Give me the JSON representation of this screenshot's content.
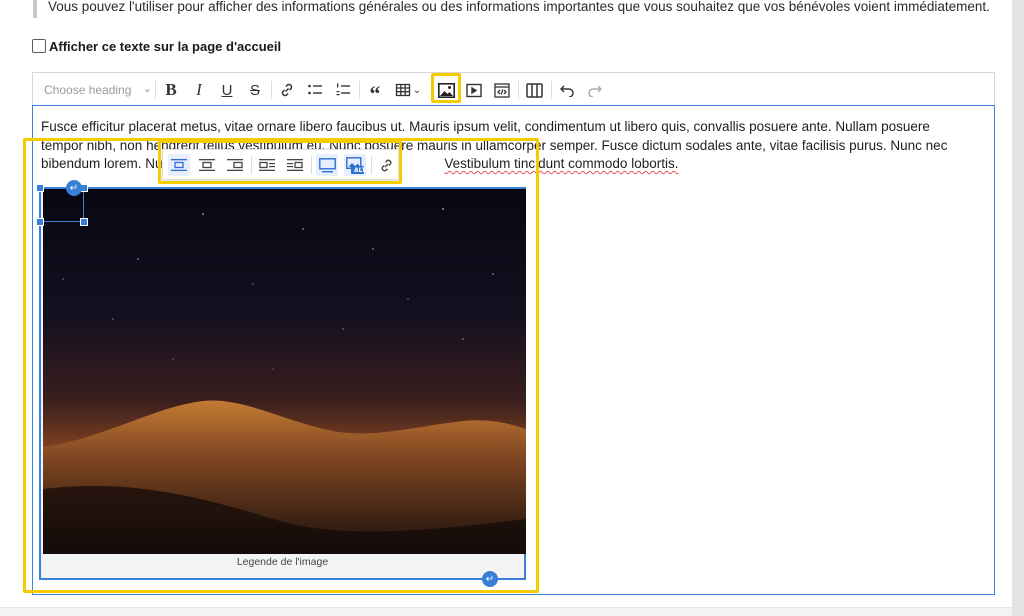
{
  "info": {
    "text": "Vous pouvez l'utiliser pour afficher des informations générales ou des informations importantes que vous souhaitez que vos bénévoles voient immédiatement."
  },
  "homepage_option": {
    "label": "Afficher ce texte sur la page d'accueil",
    "checked": false
  },
  "toolbar": {
    "heading_placeholder": "Choose heading",
    "buttons": [
      "bold",
      "italic",
      "underline",
      "strikethrough",
      "link",
      "bulleted-list",
      "numbered-list",
      "block-quote",
      "insert-table",
      "insert-image",
      "insert-media",
      "html-embed",
      "columns",
      "undo",
      "redo"
    ],
    "highlighted": "insert-image"
  },
  "editor": {
    "paragraph_before": "Fusce efficitur placerat metus, vitae ornare libero faucibus ut. Mauris ipsum velit, condimentum ut libero quis, convallis posuere ante. Nullam posuere tempor nibh, non hendrerit tellus vestibulum eu. Nunc posuere mauris in ullamcorper semper. Fusce dictum sodales ante, vitae facilisis purus. Nunc nec bibendum lorem. Nulla nec acc",
    "paragraph_after": "Vestibulum tincidunt commodo lobortis.",
    "image_caption": "Legende de l'image"
  },
  "image_toolbar": {
    "buttons": [
      "align-inline",
      "align-center",
      "align-right",
      "wrap-left",
      "wrap-right",
      "toggle-caption",
      "alt-text",
      "link-image"
    ],
    "active": [
      "align-inline",
      "toggle-caption",
      "alt-text"
    ],
    "alt_badge": "ALT"
  },
  "colors": {
    "highlight": "#f5cc00",
    "focus_blue": "#3a7fd6",
    "active_icon": "#2f6fd0"
  }
}
